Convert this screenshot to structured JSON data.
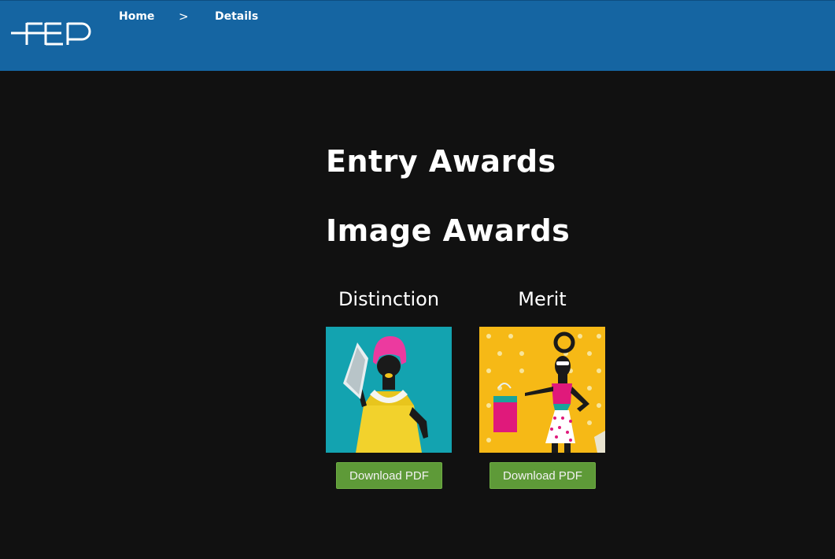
{
  "header": {
    "logo_text": "FEP",
    "breadcrumb": {
      "home": "Home",
      "separator": ">",
      "current": "Details"
    },
    "bg_color": "#1565a2"
  },
  "main": {
    "entry_awards_title": "Entry Awards",
    "image_awards_title": "Image Awards",
    "awards": [
      {
        "title": "Distinction",
        "image": "woman-with-pink-hair-holding-iron-photo",
        "button_label": "Download PDF"
      },
      {
        "title": "Merit",
        "image": "woman-with-handbag-on-polka-dot-photo",
        "button_label": "Download PDF"
      }
    ],
    "button_color": "#5e9a38"
  }
}
